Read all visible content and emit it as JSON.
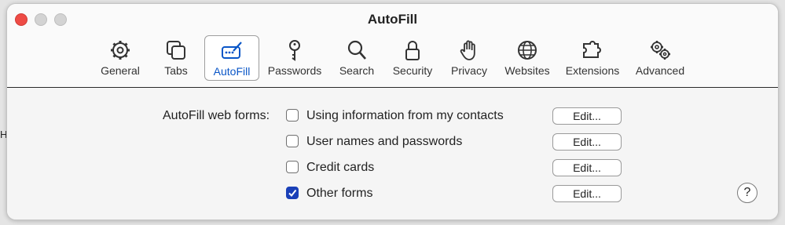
{
  "window": {
    "title": "AutoFill"
  },
  "toolbar": {
    "items": [
      {
        "label": "General",
        "icon": "gear-icon"
      },
      {
        "label": "Tabs",
        "icon": "tabs-icon"
      },
      {
        "label": "AutoFill",
        "icon": "autofill-icon",
        "selected": true
      },
      {
        "label": "Passwords",
        "icon": "key-icon"
      },
      {
        "label": "Search",
        "icon": "search-icon"
      },
      {
        "label": "Security",
        "icon": "lock-icon"
      },
      {
        "label": "Privacy",
        "icon": "hand-icon"
      },
      {
        "label": "Websites",
        "icon": "globe-icon"
      },
      {
        "label": "Extensions",
        "icon": "puzzle-icon"
      },
      {
        "label": "Advanced",
        "icon": "gears-icon"
      }
    ]
  },
  "autofill": {
    "label": "AutoFill web forms:",
    "options": [
      {
        "label": "Using information from my contacts",
        "checked": false,
        "edit": "Edit..."
      },
      {
        "label": "User names and passwords",
        "checked": false,
        "edit": "Edit..."
      },
      {
        "label": "Credit cards",
        "checked": false,
        "edit": "Edit..."
      },
      {
        "label": "Other forms",
        "checked": true,
        "edit": "Edit..."
      }
    ]
  },
  "help": {
    "label": "?"
  },
  "colors": {
    "accent": "#0a56c7",
    "checkbox_checked": "#1a40b8",
    "close": "#ee4b45"
  },
  "edge_glyph": "H"
}
